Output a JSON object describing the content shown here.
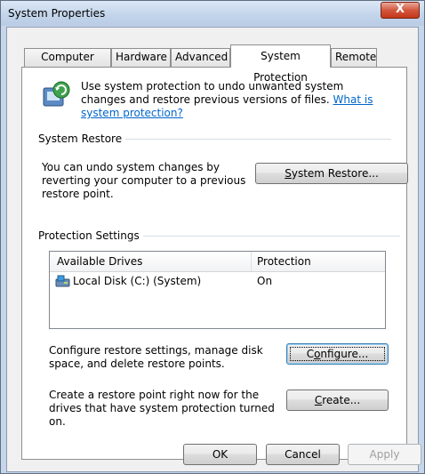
{
  "window": {
    "title": "System Properties",
    "close_glyph": "X"
  },
  "tabs": [
    {
      "label": "Computer Name",
      "active": false
    },
    {
      "label": "Hardware",
      "active": false
    },
    {
      "label": "Advanced",
      "active": false
    },
    {
      "label": "System Protection",
      "active": true
    },
    {
      "label": "Remote",
      "active": false
    }
  ],
  "intro": {
    "text": "Use system protection to undo unwanted system changes and restore previous versions of files.",
    "link": "What is system protection?",
    "icon": "shield-icon"
  },
  "system_restore": {
    "heading": "System Restore",
    "description": "You can undo system changes by reverting your computer to a previous restore point.",
    "button_label": "System Restore...",
    "button_access_key": "S"
  },
  "protection": {
    "heading": "Protection Settings",
    "columns": [
      "Available Drives",
      "Protection"
    ],
    "drives": [
      {
        "name": "Local Disk (C:) (System)",
        "protection": "On",
        "icon": "drive-icon"
      }
    ]
  },
  "configure": {
    "description": "Configure restore settings, manage disk space, and delete restore points.",
    "button_label": "Configure...",
    "button_access_key": "o"
  },
  "create": {
    "description": "Create a restore point right now for the drives that have system protection turned on.",
    "button_label": "Create...",
    "button_access_key": "C"
  },
  "footer": {
    "ok": "OK",
    "cancel": "Cancel",
    "apply": "Apply"
  }
}
